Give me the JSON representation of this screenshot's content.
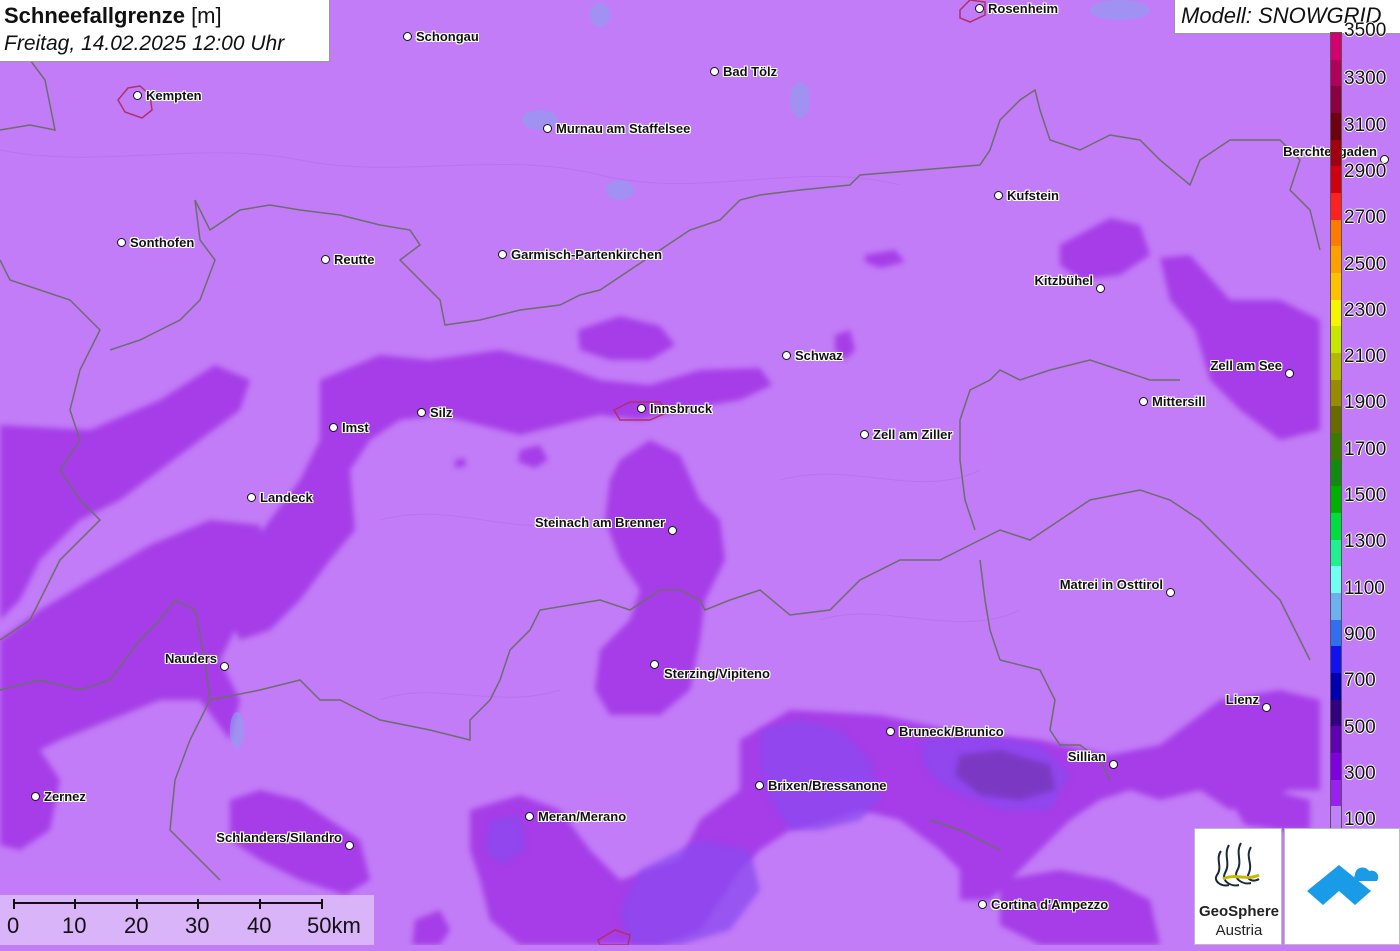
{
  "title": {
    "main_bold": "Schneefallgrenze",
    "main_unit": " [m]",
    "subtitle": "Freitag, 14.02.2025 12:00 Uhr"
  },
  "model_label": "Modell: SNOWGRID",
  "legend": {
    "labels": [
      "3500",
      "3300",
      "3100",
      "2900",
      "2700",
      "2500",
      "2300",
      "2100",
      "1900",
      "1700",
      "1500",
      "1300",
      "1100",
      "900",
      "700",
      "500",
      "300",
      "100"
    ],
    "colors": [
      "#d4006f",
      "#b1005c",
      "#8a0040",
      "#6e0010",
      "#a00010",
      "#d00010",
      "#ff2020",
      "#ff7a00",
      "#ffa000",
      "#ffc000",
      "#f5f500",
      "#c8e600",
      "#b5b800",
      "#9a8a00",
      "#6a6a00",
      "#3a7a00",
      "#108a10",
      "#00b000",
      "#00dd40",
      "#20f090",
      "#70fff0",
      "#6cb0f0",
      "#3070f0",
      "#1010f0",
      "#0000b0",
      "#350080",
      "#6000b0",
      "#8000e0",
      "#9a20f0",
      "#c080f8"
    ]
  },
  "cities": [
    {
      "name": "Rosenheim"
    },
    {
      "name": "Schongau"
    },
    {
      "name": "Bad Tölz"
    },
    {
      "name": "Kempten"
    },
    {
      "name": "Murnau am Staffelsee"
    },
    {
      "name": "Berchtesgaden"
    },
    {
      "name": "Kufstein"
    },
    {
      "name": "Sonthofen"
    },
    {
      "name": "Reutte"
    },
    {
      "name": "Garmisch-Partenkirchen"
    },
    {
      "name": "Kitzbühel"
    },
    {
      "name": "Schwaz"
    },
    {
      "name": "Zell am See"
    },
    {
      "name": "Imst"
    },
    {
      "name": "Silz"
    },
    {
      "name": "Innsbruck"
    },
    {
      "name": "Mittersill"
    },
    {
      "name": "Zell am Ziller"
    },
    {
      "name": "Landeck"
    },
    {
      "name": "Steinach am Brenner"
    },
    {
      "name": "Matrei in Osttirol"
    },
    {
      "name": "Nauders"
    },
    {
      "name": "Sterzing/Vipiteno"
    },
    {
      "name": "Lienz"
    },
    {
      "name": "Bruneck/Brunico"
    },
    {
      "name": "Sillian"
    },
    {
      "name": "Brixen/Bressanone"
    },
    {
      "name": "Zernez"
    },
    {
      "name": "Meran/Merano"
    },
    {
      "name": "Schlanders/Silandro"
    },
    {
      "name": "Cortina d'Ampezzo"
    }
  ],
  "scale": {
    "labels": [
      "0",
      "10",
      "20",
      "30",
      "40",
      "50km"
    ]
  },
  "logos": {
    "geosphere_line1": "GeoSphere",
    "geosphere_line2": "Austria"
  }
}
